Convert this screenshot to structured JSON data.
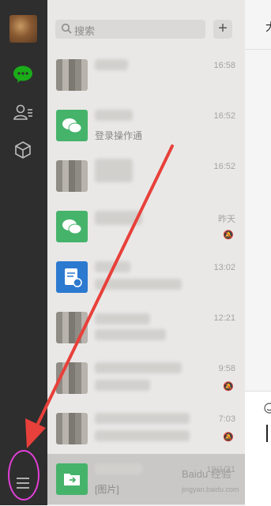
{
  "sidebar": {
    "items": [
      {
        "name": "chat",
        "icon": "chat-bubble-icon",
        "color": "#1aad19"
      },
      {
        "name": "contacts",
        "icon": "contacts-icon"
      },
      {
        "name": "favorites",
        "icon": "cube-icon"
      }
    ],
    "menu_icon": "menu-icon"
  },
  "search": {
    "placeholder": "搜索",
    "add_label": "+"
  },
  "chats": [
    {
      "name": "",
      "preview": "",
      "time": "16:58",
      "avatar": "photo",
      "muted": false
    },
    {
      "name": "",
      "preview": "登录操作通",
      "time": "16:52",
      "avatar": "wechat-green",
      "muted": false
    },
    {
      "name": "",
      "preview": "",
      "time": "16:52",
      "avatar": "photo",
      "muted": false
    },
    {
      "name": "",
      "preview": "",
      "time": "昨天",
      "avatar": "wechat-green",
      "muted": true
    },
    {
      "name": "",
      "preview": "",
      "time": "13:02",
      "avatar": "blue-doc",
      "muted": false
    },
    {
      "name": "",
      "preview": "",
      "time": "12:21",
      "avatar": "photo",
      "muted": false
    },
    {
      "name": "",
      "preview": "",
      "time": "9:58",
      "avatar": "photo",
      "muted": true
    },
    {
      "name": "",
      "preview": "",
      "time": "7:03",
      "avatar": "photo",
      "muted": true
    },
    {
      "name": "",
      "preview": "[图片]",
      "time": "19/1/31",
      "avatar": "green-file",
      "muted": false,
      "selected": true
    }
  ],
  "pane": {
    "title": "大"
  },
  "watermark": {
    "text": "Baidu 经验",
    "url": "jingyan.baidu.com"
  },
  "colors": {
    "highlight": "#e23fd8",
    "arrow": "#e8403a"
  }
}
